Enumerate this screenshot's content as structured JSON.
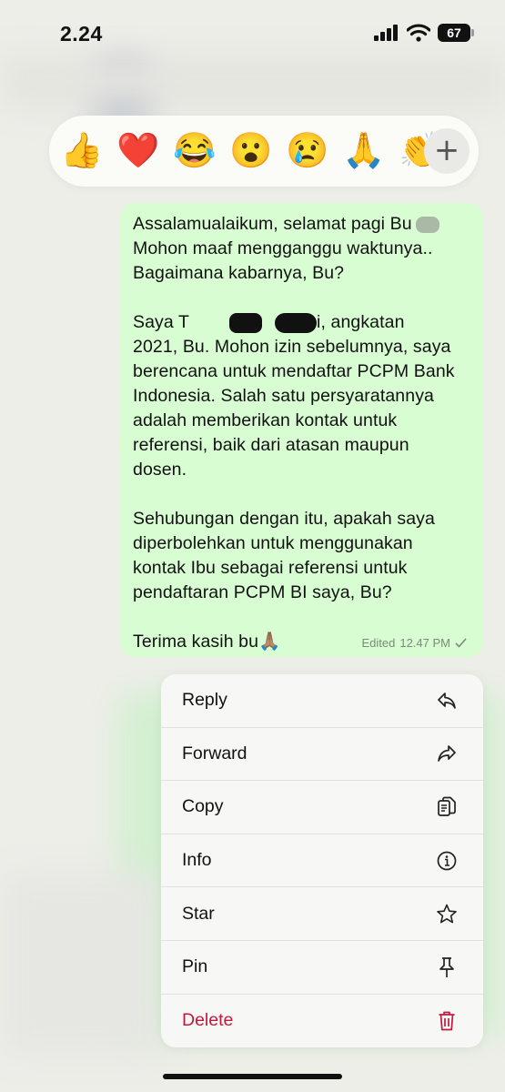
{
  "status_bar": {
    "time": "2.24",
    "battery": "67"
  },
  "reactions": {
    "emojis": [
      "👍",
      "❤️",
      "😂",
      "😮",
      "😢",
      "🙏",
      "👏"
    ],
    "more_label": "+"
  },
  "message": {
    "line1": "Assalamualaikum, selamat pagi Bu",
    "line2": "Mohon maaf mengganggu waktunya..",
    "line3": "Bagaimana kabarnya, Bu?",
    "p2_start": "Saya T",
    "p2_after_redact": "i, angkatan",
    "p2_rest": "2021, Bu. Mohon izin sebelumnya, saya\nberencana untuk mendaftar PCPM Bank\nIndonesia. Salah satu persyaratannya\nadalah memberikan kontak untuk\nreferensi, baik dari atasan maupun\ndosen.",
    "p3": "Sehubungan dengan itu, apakah saya\ndiperbolehkan untuk menggunakan\nkontak Ibu sebagai referensi untuk\npendaftaran PCPM BI saya, Bu?",
    "closing": "Terima kasih bu🙏🏽",
    "edited_label": "Edited",
    "timestamp": "12.47 PM"
  },
  "menu": {
    "items": [
      {
        "label": "Reply",
        "icon": "reply-icon"
      },
      {
        "label": "Forward",
        "icon": "forward-icon"
      },
      {
        "label": "Copy",
        "icon": "copy-icon"
      },
      {
        "label": "Info",
        "icon": "info-icon"
      },
      {
        "label": "Star",
        "icon": "star-icon"
      },
      {
        "label": "Pin",
        "icon": "pin-icon"
      },
      {
        "label": "Delete",
        "icon": "trash-icon"
      }
    ]
  },
  "colors": {
    "bubble": "#d9fdd3",
    "delete": "#c2183f",
    "background": "#eeeee9"
  }
}
